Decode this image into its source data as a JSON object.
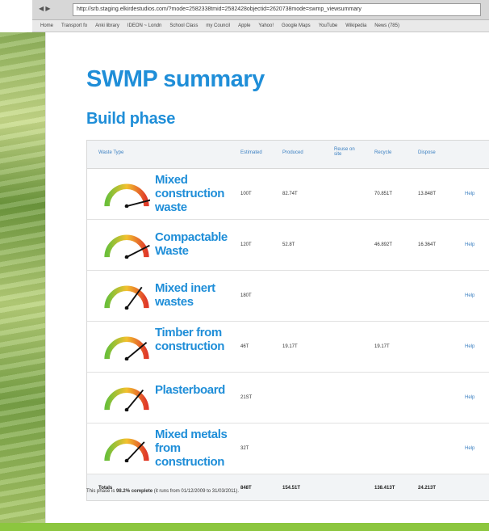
{
  "browser": {
    "url": "http://srb.staging.elkirdestudios.com/?mode=2582338tmid=2582428objectid=2620738mode=swmp_viewsummary",
    "bookmarks": [
      "Home",
      "Transport fo",
      "Anki library",
      "IDEON ~ Londn",
      "School Class",
      "my Council",
      "Apple",
      "Yahoo!",
      "Google Maps",
      "YouTube",
      "Wikipedia",
      "News (785)"
    ]
  },
  "page": {
    "title": "SWMP summary",
    "subtitle": "Build phase"
  },
  "table": {
    "headers": {
      "waste_type": "Waste Type",
      "estimated": "Estimated",
      "produced": "Produced",
      "reuse": "Reuse on site",
      "recycle": "Recycle",
      "dispose": "Dispose"
    },
    "rows": [
      {
        "name": "Mixed construction waste",
        "estimated": "100T",
        "produced": "82.74T",
        "reuse": "",
        "recycle": "70.851T",
        "dispose": "13.848T",
        "help": "Help",
        "gauge_level": 0.92
      },
      {
        "name": "Compactable Waste",
        "estimated": "120T",
        "produced": "52.8T",
        "reuse": "",
        "recycle": "46.892T",
        "dispose": "16.364T",
        "help": "Help",
        "gauge_level": 0.85
      },
      {
        "name": "Mixed inert wastes",
        "estimated": "180T",
        "produced": "",
        "reuse": "",
        "recycle": "",
        "dispose": "",
        "help": "Help",
        "gauge_level": 0.7
      },
      {
        "name": "Timber from construction",
        "estimated": "46T",
        "produced": "19.17T",
        "reuse": "",
        "recycle": "19.17T",
        "dispose": "",
        "help": "Help",
        "gauge_level": 0.78
      },
      {
        "name": "Plasterboard",
        "estimated": "21ST",
        "produced": "",
        "reuse": "",
        "recycle": "",
        "dispose": "",
        "help": "Help",
        "gauge_level": 0.72
      },
      {
        "name": "Mixed metals from construction",
        "estimated": "32T",
        "produced": "",
        "reuse": "",
        "recycle": "",
        "dispose": "",
        "help": "Help",
        "gauge_level": 0.74
      }
    ],
    "totals": {
      "label": "Totals",
      "estimated": "848T",
      "produced": "154.51T",
      "recycle": "138.413T",
      "dispose": "24.213T"
    }
  },
  "footer": {
    "prefix": "This phase is",
    "percent": "98.2% complete",
    "suffix": "(it runs from 01/12/2009 to 31/03/2011)."
  },
  "colors": {
    "accent": "#1f8ed8",
    "link": "#3a7fc1",
    "green": "#8cc63f"
  }
}
